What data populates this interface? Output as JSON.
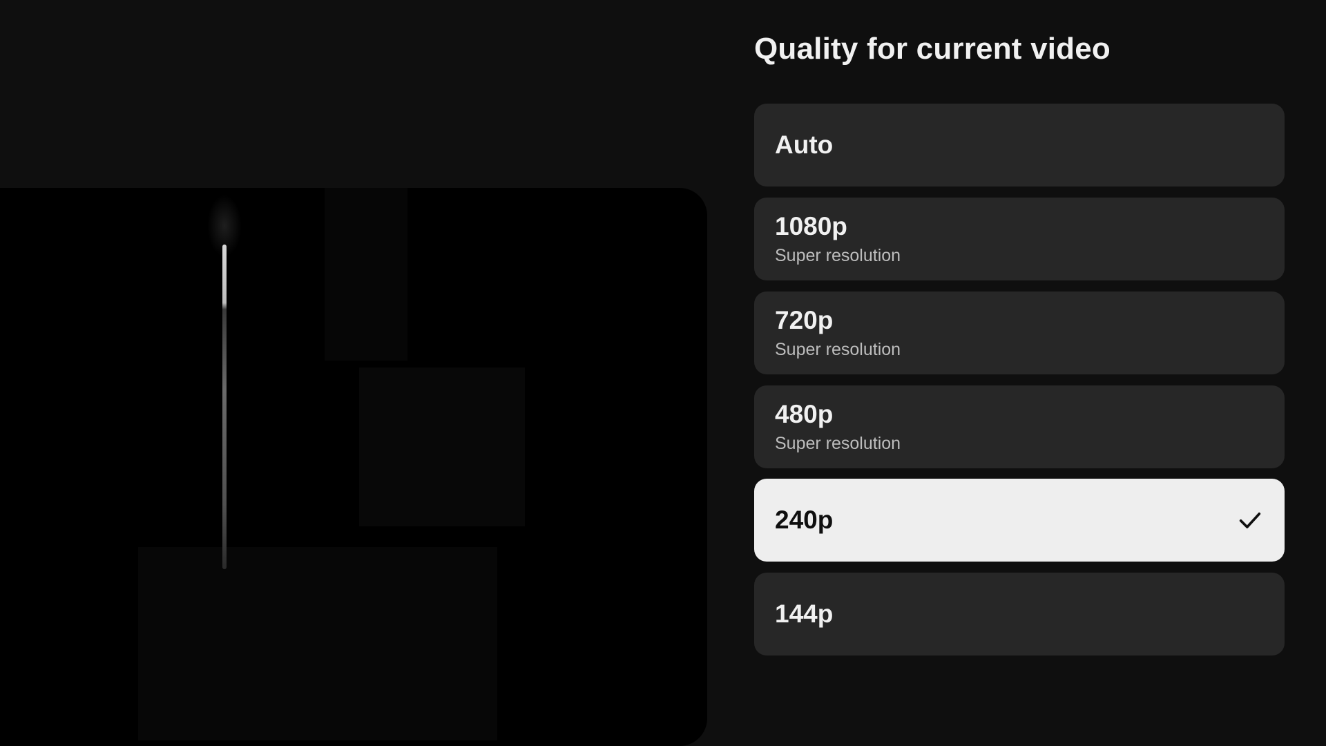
{
  "panel": {
    "title": "Quality for current video",
    "options": [
      {
        "label": "Auto",
        "sub": "",
        "selected": false
      },
      {
        "label": "1080p",
        "sub": "Super resolution",
        "selected": false
      },
      {
        "label": "720p",
        "sub": "Super resolution",
        "selected": false
      },
      {
        "label": "480p",
        "sub": "Super resolution",
        "selected": false
      },
      {
        "label": "240p",
        "sub": "",
        "selected": true
      },
      {
        "label": "144p",
        "sub": "",
        "selected": false
      }
    ]
  },
  "icons": {
    "selected_indicator": "checkmark-icon"
  },
  "colors": {
    "background": "#0f0f0f",
    "option_bg": "#272727",
    "selected_bg": "#eeeeee",
    "text_primary": "#f1f1f1",
    "text_secondary": "#bdbdbd"
  }
}
